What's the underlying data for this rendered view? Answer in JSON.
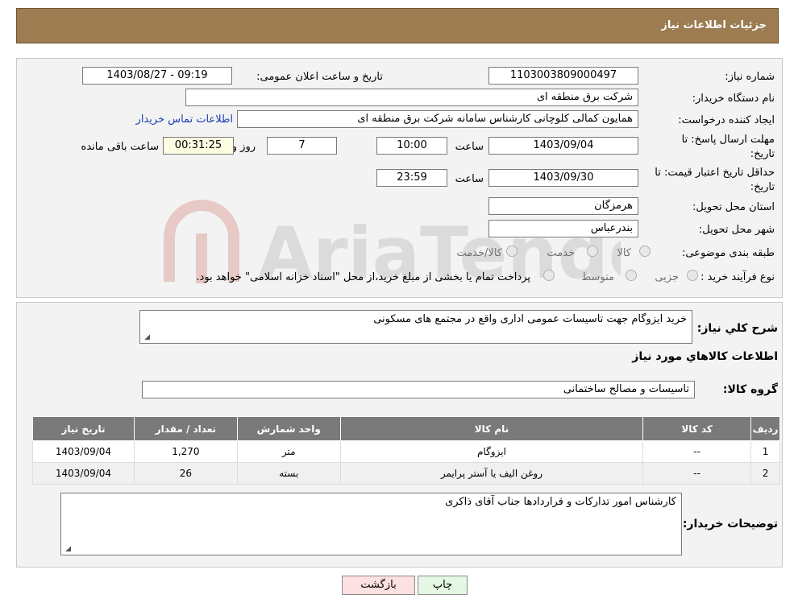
{
  "header": {
    "title": "جزئیات اطلاعات نیاز"
  },
  "form": {
    "need_number_label": "شماره نیاز:",
    "need_number": "1103003809000497",
    "announce_label": "تاریخ و ساعت اعلان عمومی:",
    "announce_value": "1403/08/27 - 09:19",
    "buyer_org_label": "نام دستگاه خریدار:",
    "buyer_org": "شرکت برق منطقه ای",
    "creator_label": "ایجاد کننده درخواست:",
    "creator": "همایون کمالی کلوچانی کارشناس سامانه شرکت برق منطقه ای",
    "contact_link": "اطلاعات تماس خریدار",
    "deadline_label_1": "مهلت ارسال پاسخ: تا",
    "deadline_label_2": "تاریخ:",
    "deadline_date": "1403/09/04",
    "hour_label": "ساعت",
    "deadline_time": "10:00",
    "days_value": "7",
    "days_label": "روز و",
    "remaining_time": "00:31:25",
    "remaining_label": "ساعت باقی مانده",
    "validity_label_1": "حداقل تاریخ اعتبار قیمت: تا",
    "validity_label_2": "تاریخ:",
    "validity_date": "1403/09/30",
    "validity_hour_label": "ساعت",
    "validity_time": "23:59",
    "province_label": "استان محل تحویل:",
    "province": "هرمزگان",
    "city_label": "شهر محل تحویل:",
    "city": "بندرعباس",
    "category_label": "طبقه بندی موضوعی:",
    "category_options": [
      "کالا",
      "خدمت",
      "کالا/خدمت"
    ],
    "process_label": "نوع فرآیند خرید :",
    "process_options": [
      "جزیی",
      "متوسط"
    ],
    "process_note": "پرداخت تمام یا بخشی از مبلغ خرید،از محل \"اسناد خزانه اسلامی\" خواهد بود."
  },
  "details": {
    "description_label": "شرح کلي نياز:",
    "description": "خرید ایزوگام جهت تاسیسات عمومی اداری واقع در مجتمع های مسکونی",
    "goods_info_title": "اطلاعات کالاهاي مورد نياز",
    "goods_group_label": "گروه کالا:",
    "goods_group": "تاسیسات و مصالح ساختمانی",
    "table": {
      "headers": [
        "ردیف",
        "کد کالا",
        "نام کالا",
        "واحد شمارش",
        "تعداد / مقدار",
        "تاریخ نیاز"
      ],
      "rows": [
        [
          "1",
          "--",
          "ایزوگام",
          "متر",
          "1,270",
          "1403/09/04"
        ],
        [
          "2",
          "--",
          "روغن الیف یا آستر پرایمر",
          "بسته",
          "26",
          "1403/09/04"
        ]
      ]
    },
    "buyer_notes_label": "توضیحات خریدار:",
    "buyer_notes": "کارشناس امور تدارکات و قراردادها جناب آقای ذاکری"
  },
  "buttons": {
    "print": "چاپ",
    "back": "بازگشت"
  },
  "watermark": {
    "text": "AriaTender.neT"
  },
  "colors": {
    "header_bg": "#9c7c50",
    "table_header_bg": "#7a7a7a",
    "link": "#1a3fb0"
  }
}
